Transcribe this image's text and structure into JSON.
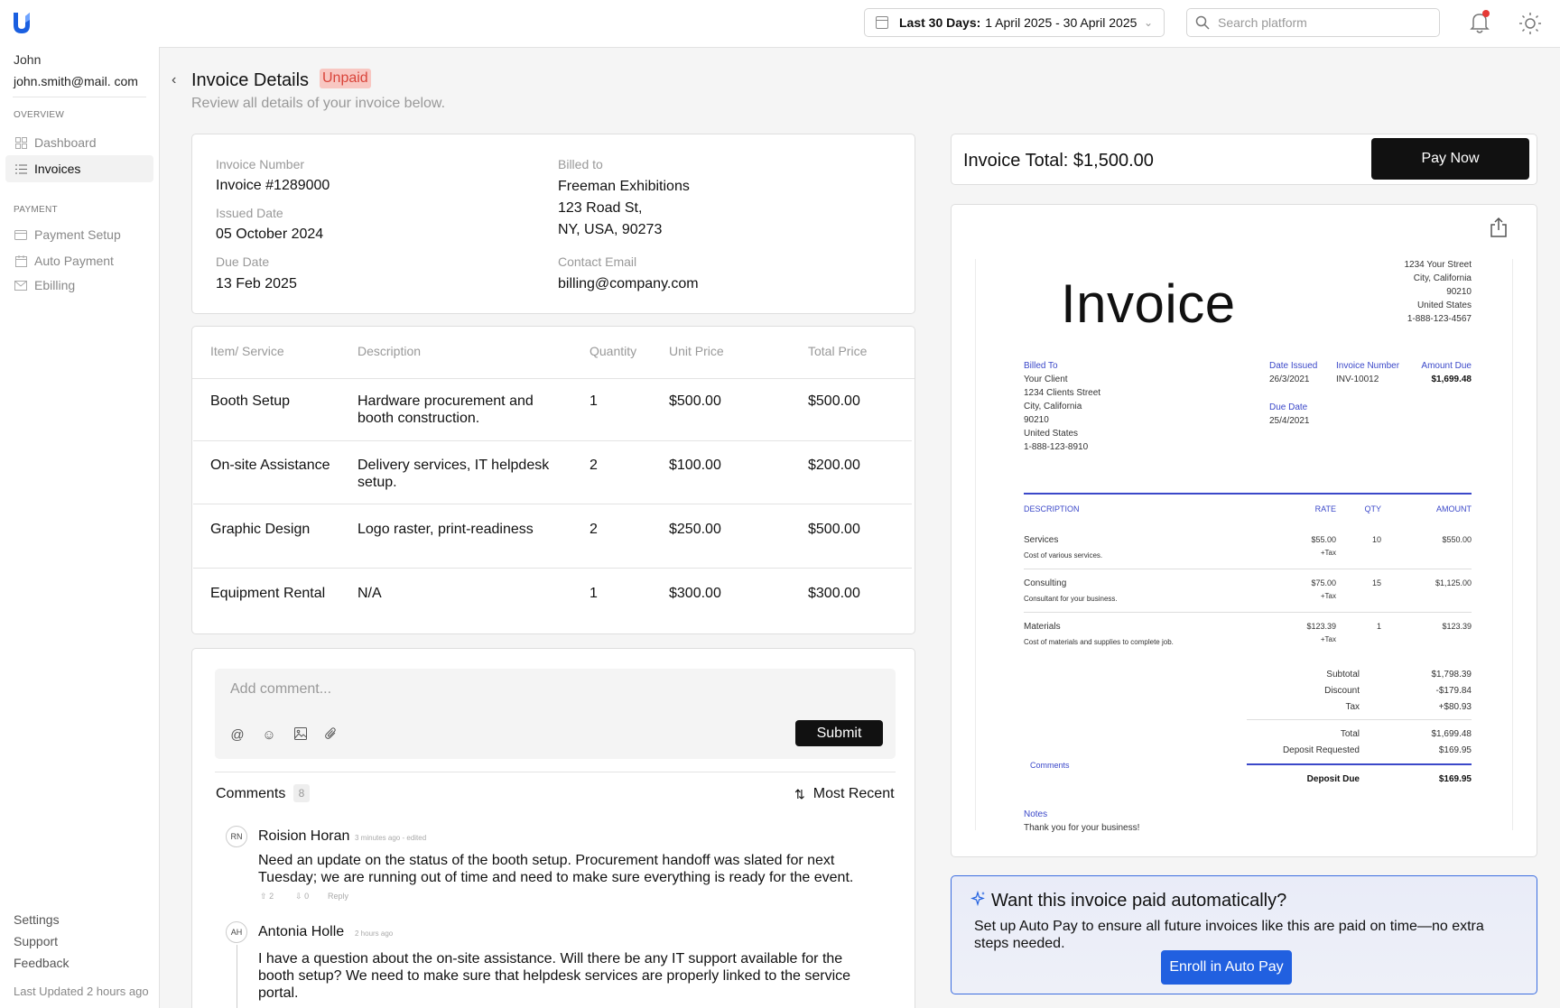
{
  "topbar": {
    "date_prefix": "Last 30 Days:",
    "date_range": "1 April 2025 - 30 April 2025",
    "search_placeholder": "Search platform"
  },
  "sidebar": {
    "user_name": "John",
    "user_email": "john.smith@mail. com",
    "overview_label": "OVERVIEW",
    "overview_items": [
      {
        "label": "Dashboard",
        "icon": "grid-icon"
      },
      {
        "label": "Invoices",
        "icon": "list-icon"
      }
    ],
    "payment_label": "PAYMENT",
    "payment_items": [
      {
        "label": "Payment Setup",
        "icon": "card-icon"
      },
      {
        "label": "Auto Payment",
        "icon": "calendar-icon"
      },
      {
        "label": "Ebilling",
        "icon": "mail-icon"
      }
    ],
    "footer_items": [
      "Settings",
      "Support",
      "Feedback"
    ],
    "last_updated": "Last Updated 2 hours ago"
  },
  "header": {
    "title": "Invoice Details",
    "status": "Unpaid",
    "subtitle": "Review all details of your invoice below."
  },
  "details": {
    "invoice_number_label": "Invoice Number",
    "invoice_number": "Invoice #1289000",
    "issued_label": "Issued Date",
    "issued": "05 October 2024",
    "due_label": "Due Date",
    "due": "13 Feb 2025",
    "billed_label": "Billed to",
    "billed_name": "Freeman Exhibitions",
    "billed_street": "123 Road St,",
    "billed_city": "NY, USA, 90273",
    "email_label": "Contact Email",
    "email": "billing@company.com"
  },
  "items_table": {
    "headers": [
      "Item/ Service",
      "Description",
      "Quantity",
      "Unit Price",
      "Total Price"
    ],
    "rows": [
      {
        "item": "Booth Setup",
        "desc1": "Hardware procurement and",
        "desc2": "booth construction.",
        "qty": "1",
        "unit": "$500.00",
        "total": "$500.00"
      },
      {
        "item": "On-site Assistance",
        "desc1": "Delivery services, IT helpdesk",
        "desc2": "setup.",
        "qty": "2",
        "unit": "$100.00",
        "total": "$200.00"
      },
      {
        "item": "Graphic Design",
        "desc1": "Logo raster, print-readiness",
        "desc2": "",
        "qty": "2",
        "unit": "$250.00",
        "total": "$500.00"
      },
      {
        "item": "Equipment Rental",
        "desc1": "N/A",
        "desc2": "",
        "qty": "1",
        "unit": "$300.00",
        "total": "$300.00"
      }
    ]
  },
  "comment_form": {
    "placeholder": "Add comment...",
    "submit": "Submit"
  },
  "comments": {
    "title": "Comments",
    "count": "8",
    "sort": "Most Recent",
    "items": [
      {
        "initials": "RN",
        "author": "Roision Horan",
        "meta": "3 minutes ago - edited",
        "line1": "Need an update on the status of the booth setup. Procurement handoff was slated for next",
        "line2": "Tuesday; we are running out of time and need to make sure everything is ready for the event.",
        "line3": "",
        "up": "2",
        "down": "0",
        "reply": "Reply"
      },
      {
        "initials": "AH",
        "author": "Antonia Holle",
        "meta": "2 hours ago",
        "line1": "I have a question about the on-site assistance. Will there be any IT support available for the",
        "line2": "booth setup? We need to make sure that helpdesk services are properly linked to the service",
        "line3": "portal."
      }
    ]
  },
  "total": {
    "label": "Invoice Total: $1,500.00",
    "pay": "Pay Now"
  },
  "invoice_preview": {
    "heading": "Invoice",
    "from": [
      "1234 Your Street",
      "City, California",
      "90210",
      "United States",
      "1-888-123-4567"
    ],
    "billed_to_label": "Billed To",
    "billed_to": [
      "Your Client",
      "1234 Clients Street",
      "City, California",
      "90210",
      "United States",
      "1-888-123-8910"
    ],
    "date_issued_label": "Date Issued",
    "date_issued": "26/3/2021",
    "invoice_number_label": "Invoice Number",
    "invoice_number": "INV-10012",
    "amount_due_label": "Amount Due",
    "amount_due": "$1,699.48",
    "due_date_label": "Due Date",
    "due_date": "25/4/2021",
    "col_desc": "DESCRIPTION",
    "col_rate": "RATE",
    "col_qty": "QTY",
    "col_amount": "AMOUNT",
    "lines": [
      {
        "name": "Services",
        "sub": "Cost of various services.",
        "rate": "$55.00",
        "tax": "+Tax",
        "qty": "10",
        "amount": "$550.00"
      },
      {
        "name": "Consulting",
        "sub": "Consultant for your business.",
        "rate": "$75.00",
        "tax": "+Tax",
        "qty": "15",
        "amount": "$1,125.00"
      },
      {
        "name": "Materials",
        "sub": "Cost of materials and supplies to complete job.",
        "rate": "$123.39",
        "tax": "+Tax",
        "qty": "1",
        "amount": "$123.39"
      }
    ],
    "subtotal_label": "Subtotal",
    "subtotal": "$1,798.39",
    "discount_label": "Discount",
    "discount": "-$179.84",
    "tax_label": "Tax",
    "tax": "+$80.93",
    "total_label": "Total",
    "total": "$1,699.48",
    "deposit_req_label": "Deposit Requested",
    "deposit_req": "$169.95",
    "deposit_due_label": "Deposit Due",
    "deposit_due": "$169.95",
    "comments_label": "Comments",
    "notes_label": "Notes",
    "notes": "Thank you for your business!"
  },
  "promo": {
    "title": "Want this invoice paid automatically?",
    "text": "Set up Auto Pay to ensure all future invoices like this are paid on time—no extra steps needed.",
    "button": "Enroll in Auto Pay"
  },
  "colors": {
    "accent": "#2160e0",
    "unpaid_bg": "#f8c7c2",
    "unpaid_text": "#d9443a",
    "preview_blue": "#3b48c9",
    "primary_button": "#111111"
  }
}
